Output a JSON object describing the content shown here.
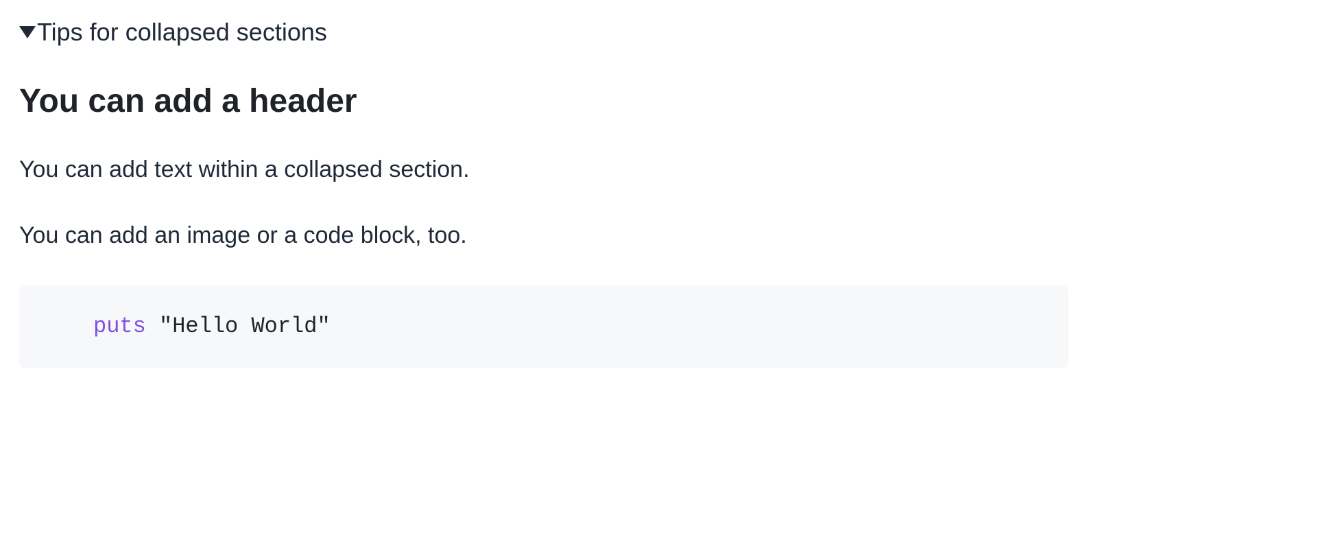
{
  "summary": {
    "label": "Tips for collapsed sections"
  },
  "content": {
    "header": "You can add a header",
    "paragraph1": "You can add text within a collapsed section.",
    "paragraph2": "You can add an image or a code block, too.",
    "code": {
      "keyword": "puts",
      "string": "\"Hello World\""
    }
  }
}
